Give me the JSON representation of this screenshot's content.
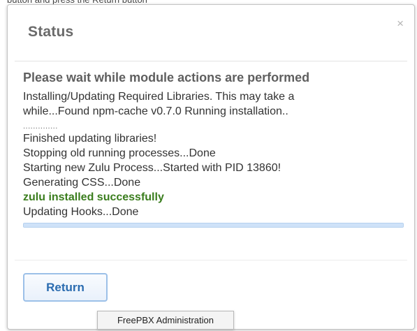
{
  "dialog": {
    "title": "Status",
    "close_symbol": "×",
    "heading": "Please wait while module actions are performed",
    "log": {
      "installing_line1": "Installing/Updating Required Libraries. This may take a",
      "installing_line2": "while...Found npm-cache v0.7.0 Running installation..",
      "dots": "..............",
      "finished": "Finished updating libraries!",
      "stopping": "Stopping old running processes...Done",
      "starting": "Starting new Zulu Process...Started with PID 13860!",
      "css": "Generating CSS...Done",
      "success": "zulu installed successfully",
      "hooks": "Updating Hooks...Done"
    },
    "progress_fraction": 1.0,
    "return_label": "Return"
  },
  "tooltip": {
    "text": "FreePBX Administration"
  },
  "colors": {
    "success_text": "#3a7d1d",
    "button_text": "#2b6cb0",
    "button_border": "#9cc0e8",
    "progress_fill": "#cfe2f8"
  },
  "icons": {
    "close": "close-icon"
  }
}
